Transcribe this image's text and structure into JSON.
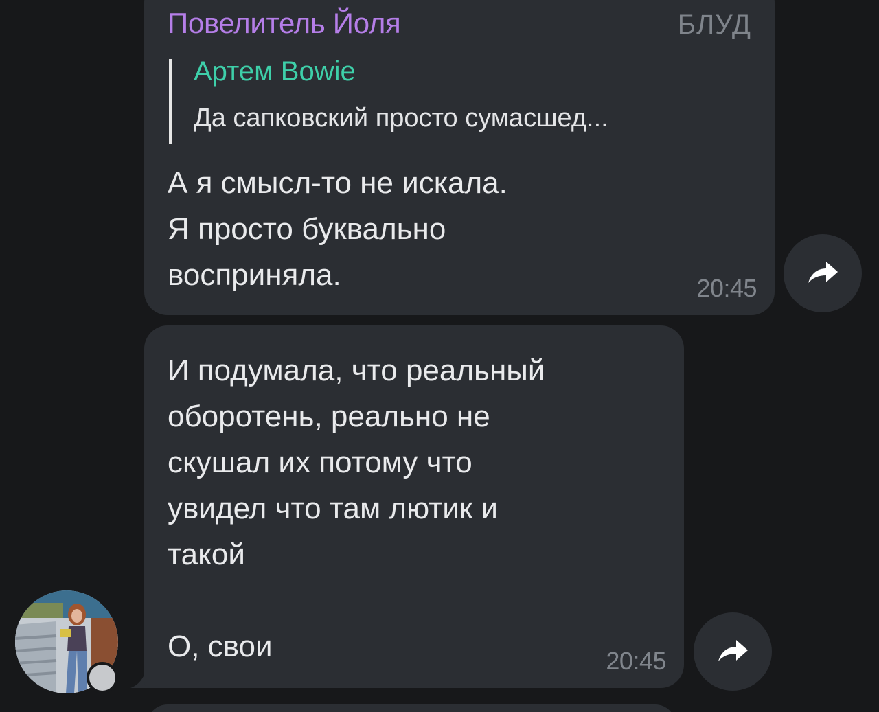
{
  "messages": [
    {
      "sender": "Повелитель Йоля",
      "sender_tag": "БЛУД",
      "reply": {
        "author": "Артем Bowie",
        "text": "Да сапковский просто сумасшед..."
      },
      "text": "А я смысл-то не искала.\nЯ просто буквально\nвосприняла.",
      "time": "20:45"
    },
    {
      "text": "И подумала, что реальный\nоборотень, реально не\nскушал их потому что\nувидел что там лютик и\nтакой\n\nО, свои",
      "time": "20:45"
    }
  ],
  "icons": {
    "share": "share-arrow-icon",
    "avatar": "user-avatar"
  },
  "colors": {
    "background": "#17181a",
    "bubble": "#2b2e33",
    "sender_name": "#b57ee8",
    "reply_author": "#3ecfa9",
    "muted": "#80858c"
  }
}
